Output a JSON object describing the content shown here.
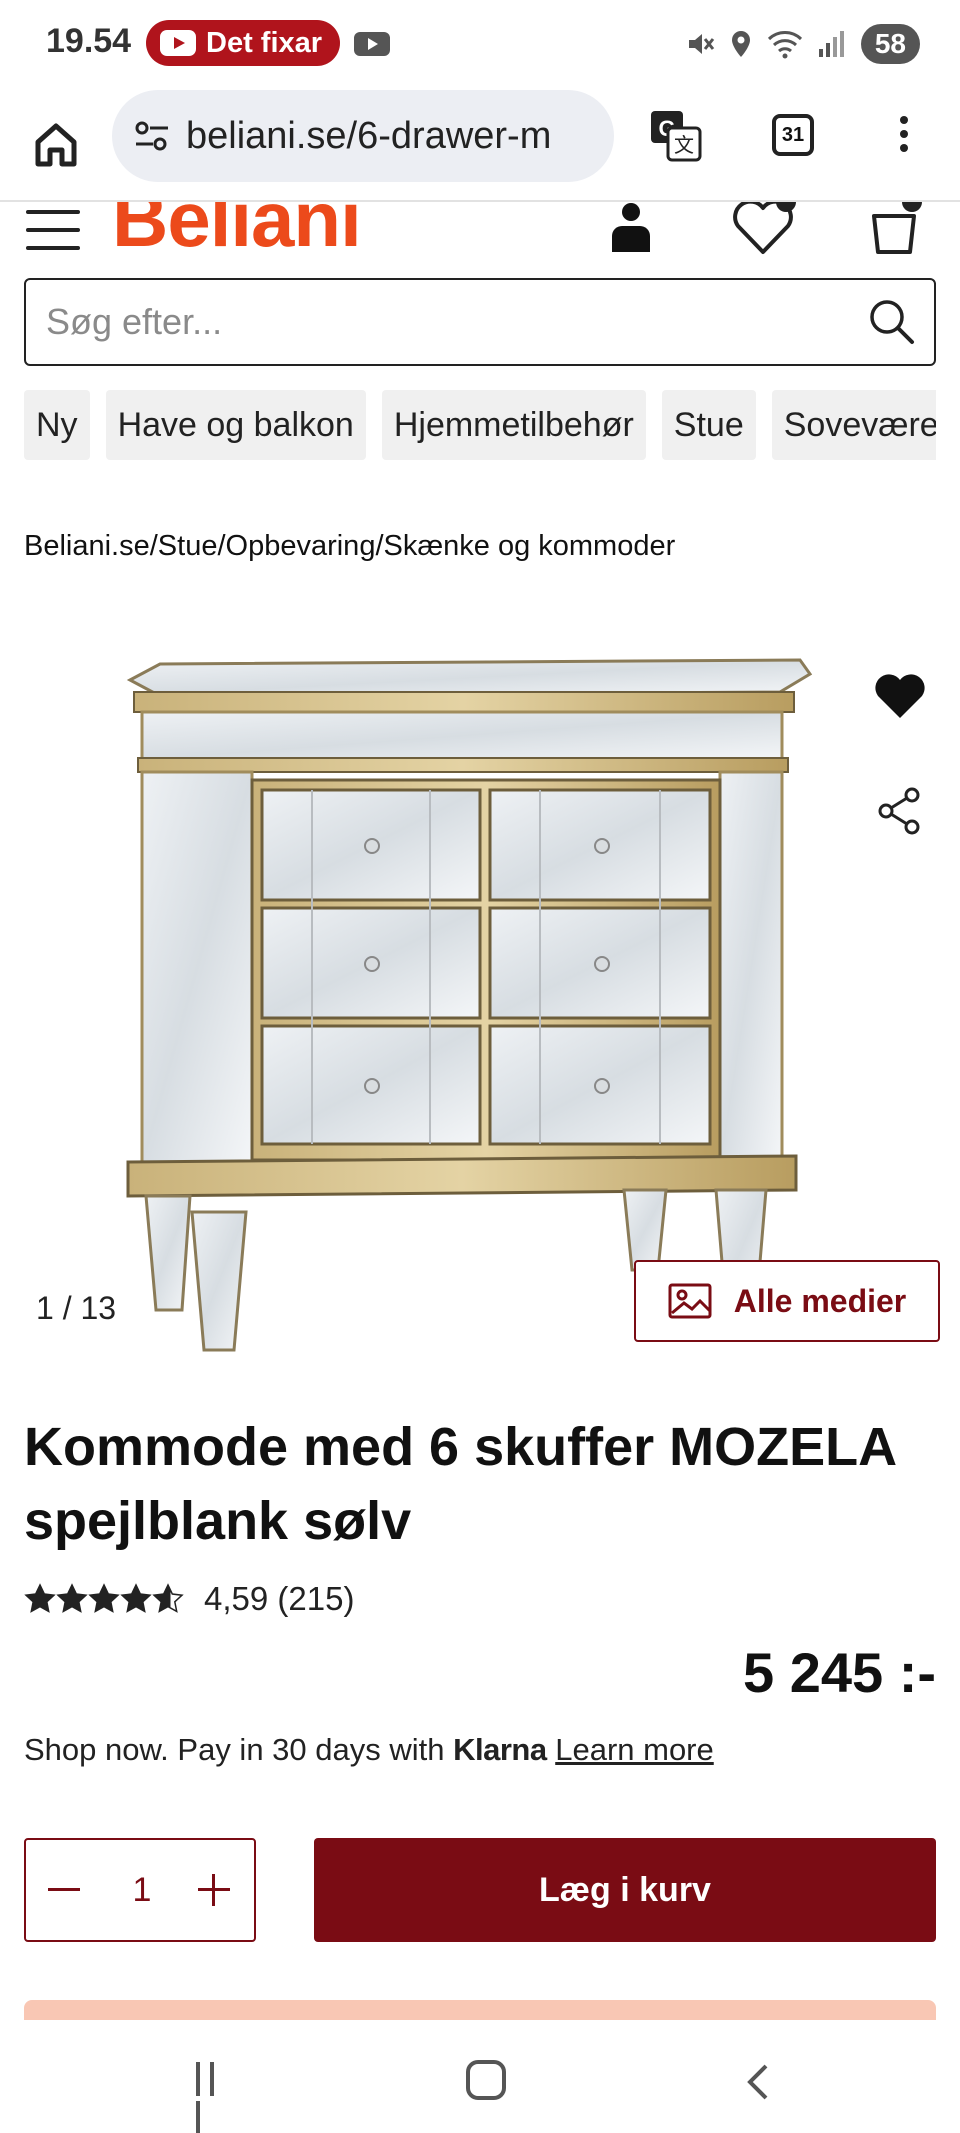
{
  "status_bar": {
    "time": "19.54",
    "notification_pill": "Det fixar",
    "battery": "58"
  },
  "browser": {
    "url": "beliani.se/6-drawer-m",
    "tab_count": "31"
  },
  "site": {
    "logo": "Beliani",
    "search_placeholder": "Søg efter...",
    "categories": [
      "Ny",
      "Have og balkon",
      "Hjemmetilbehør",
      "Stue",
      "Soveværelse"
    ],
    "breadcrumb": "Beliani.se/Stue/Opbevaring/Skænke og kommoder"
  },
  "gallery": {
    "counter": "1 /  13",
    "all_media_label": "Alle medier"
  },
  "product": {
    "title": "Kommode med 6 skuffer MOZELA spejlblank sølv",
    "rating_value": 4.59,
    "rating_text": "4,59 (215)",
    "price": "5 245 :-",
    "klarna_prefix": "Shop now. Pay in 30 days with",
    "klarna_brand": "Klarna",
    "klarna_link": "Learn more",
    "quantity": "1",
    "add_to_cart_label": "Læg i kurv"
  },
  "colors": {
    "brand_orange": "#ec4a1b",
    "primary_dark_red": "#7a0c14",
    "promo_peach": "#f9c7b4"
  }
}
